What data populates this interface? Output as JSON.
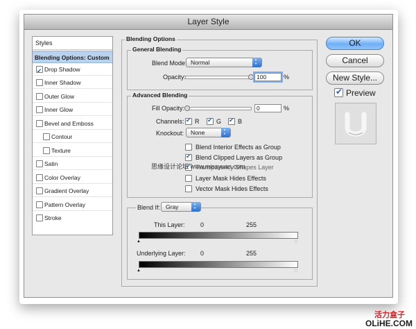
{
  "window": {
    "title": "Layer Style"
  },
  "styles_panel": {
    "header": "Styles",
    "selected": "Blending Options: Custom",
    "items": [
      {
        "label": "Drop Shadow",
        "checked": true
      },
      {
        "label": "Inner Shadow",
        "checked": false
      },
      {
        "label": "Outer Glow",
        "checked": false
      },
      {
        "label": "Inner Glow",
        "checked": false
      },
      {
        "label": "Bevel and Emboss",
        "checked": false
      },
      {
        "label": "Contour",
        "checked": false
      },
      {
        "label": "Texture",
        "checked": false
      },
      {
        "label": "Satin",
        "checked": false
      },
      {
        "label": "Color Overlay",
        "checked": false
      },
      {
        "label": "Gradient Overlay",
        "checked": false
      },
      {
        "label": "Pattern Overlay",
        "checked": false
      },
      {
        "label": "Stroke",
        "checked": false
      }
    ]
  },
  "blending_options": {
    "title": "Blending Options",
    "general": {
      "title": "General Blending",
      "blend_mode_label": "Blend Mode:",
      "blend_mode_value": "Normal",
      "opacity_label": "Opacity:",
      "opacity_value": "100",
      "opacity_unit": "%"
    },
    "advanced": {
      "title": "Advanced Blending",
      "fill_opacity_label": "Fill Opacity:",
      "fill_opacity_value": "0",
      "fill_opacity_unit": "%",
      "channels_label": "Channels:",
      "channel_r": "R",
      "channel_g": "G",
      "channel_b": "B",
      "knockout_label": "Knockout:",
      "knockout_value": "None",
      "options": [
        {
          "label": "Blend Interior Effects as Group",
          "checked": false
        },
        {
          "label": "Blend Clipped Layers as Group",
          "checked": true
        },
        {
          "label": "Transparency Shapes Layer",
          "checked": true
        },
        {
          "label": "Layer Mask Hides Effects",
          "checked": false
        },
        {
          "label": "Vector Mask Hides Effects",
          "checked": false
        }
      ]
    },
    "blend_if": {
      "label": "Blend If:",
      "value": "Gray",
      "this_layer_label": "This Layer:",
      "this_layer_min": "0",
      "this_layer_max": "255",
      "underlying_label": "Underlying Layer:",
      "underlying_min": "0",
      "underlying_max": "255"
    }
  },
  "buttons": {
    "ok": "OK",
    "cancel": "Cancel",
    "new_style": "New Style..."
  },
  "preview": {
    "label": "Preview",
    "checked": true
  },
  "watermark": {
    "center": "思缘设计论坛 www.missyuan.com",
    "brand_cn": "活力盒子",
    "brand_en": "OLiHE.COM"
  },
  "colors": {
    "accent": "#2a63b6",
    "selection": "#b9d3ee",
    "brand_red": "#d8232a"
  }
}
